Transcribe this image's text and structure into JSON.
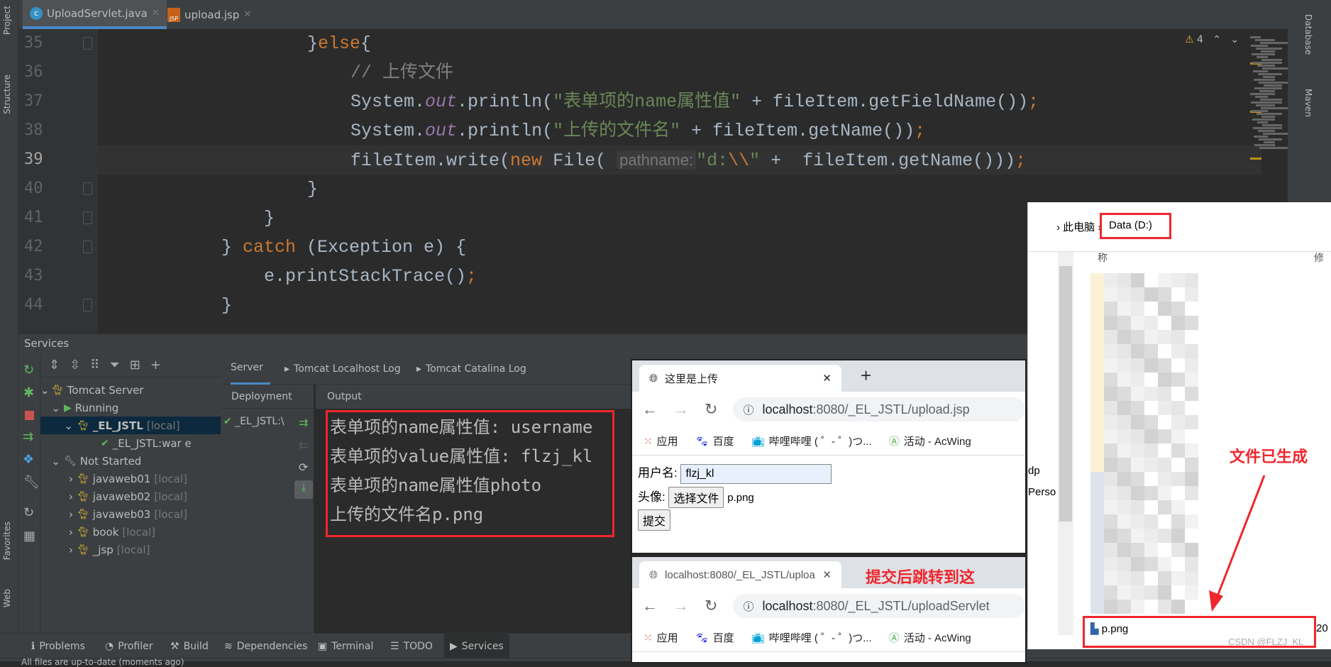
{
  "ide": {
    "left_strip": [
      "Project",
      "Structure",
      "Favorites",
      "Web"
    ],
    "right_strip": [
      "Database",
      "Maven"
    ],
    "tabs": [
      {
        "label": "UploadServlet.java",
        "active": true,
        "icon": "java-class-icon"
      },
      {
        "label": "upload.jsp",
        "active": false,
        "icon": "jsp-file-icon"
      }
    ],
    "warnings": "4",
    "line_numbers": [
      "35",
      "36",
      "37",
      "38",
      "39",
      "40",
      "41",
      "42",
      "43",
      "44"
    ],
    "current_line": "39",
    "code": {
      "l35_a": "}",
      "l35_kw": "else",
      "l35_b": "{",
      "l36": "// 上传文件",
      "l37_a": "System.",
      "l37_f": "out",
      "l37_b": ".println(",
      "l37_s": "\"表单项的name属性值\"",
      "l37_c": " + fileItem.getFieldName())",
      "l37_d": ";",
      "l38_a": "System.",
      "l38_f": "out",
      "l38_b": ".println(",
      "l38_s": "\"上传的文件名\"",
      "l38_c": " + fileItem.getName())",
      "l38_d": ";",
      "l39_a": "fileItem.write(",
      "l39_kw": "new",
      "l39_b": " File(",
      "l39_hint": "pathname:",
      "l39_s1": "\"d:",
      "l39_esc": "\\\\",
      "l39_s2": "\"",
      "l39_c": " +  fileItem.getName()))",
      "l39_d": ";",
      "l40": "}",
      "l41": "}",
      "l42_a": "} ",
      "l42_kw": "catch",
      "l42_b": " (Exception e) {",
      "l43_a": "e.printStackTrace()",
      "l43_d": ";",
      "l44": "}"
    },
    "services": {
      "title": "Services",
      "tree": [
        {
          "label": "Tomcat Server",
          "suffix": ""
        },
        {
          "label": "Running",
          "suffix": ""
        },
        {
          "label": "_EL_JSTL",
          "suffix": "[local]"
        },
        {
          "label": "_EL_JSTL:war e",
          "suffix": ""
        },
        {
          "label": "Not Started",
          "suffix": ""
        },
        {
          "label": "javaweb01",
          "suffix": "[local]"
        },
        {
          "label": "javaweb02",
          "suffix": "[local]"
        },
        {
          "label": "javaweb03",
          "suffix": "[local]"
        },
        {
          "label": "book",
          "suffix": "[local]"
        },
        {
          "label": "_jsp",
          "suffix": "[local]"
        }
      ],
      "tabs": [
        "Server",
        "Tomcat Localhost Log",
        "Tomcat Catalina Log"
      ],
      "deployment_header": "Deployment",
      "deployment_item": "_EL_JSTL:\\",
      "output_header": "Output",
      "output_lines": [
        "表单项的name属性值: username",
        "表单项的value属性值:  flzj_kl",
        "表单项的name属性值photo",
        "上传的文件名p.png"
      ]
    },
    "bottom_tabs": [
      "Problems",
      "Profiler",
      "Build",
      "Dependencies",
      "Terminal",
      "TODO",
      "Services"
    ],
    "status": "All files are up-to-date (moments ago)"
  },
  "browser1": {
    "tab_title": "这里是上传",
    "url_host": "localhost",
    "url_rest": ":8080/_EL_JSTL/upload.jsp",
    "bookmarks": [
      "应用",
      "百度",
      "哔哩哔哩 ( ゜- ゜)つ...",
      "活动 - AcWing"
    ],
    "form": {
      "username_label": "用户名:",
      "username_value": "flzj_kl",
      "avatar_label": "头像:",
      "file_button": "选择文件",
      "file_name": "p.png",
      "submit": "提交"
    }
  },
  "browser2": {
    "tab_title": "localhost:8080/_EL_JSTL/uploa",
    "url_host": "localhost",
    "url_rest": ":8080/_EL_JSTL/uploadServlet",
    "bookmarks": [
      "应用",
      "百度",
      "哔哩哔哩 ( ゜- ゜)つ...",
      "活动 - AcWing"
    ]
  },
  "explorer": {
    "breadcrumb": [
      "此电脑",
      "Data (D:)"
    ],
    "col_name": "称",
    "col_modified": "修",
    "side_labels": [
      "dp",
      "Perso"
    ],
    "file": "p.png",
    "file_date": "20"
  },
  "annotations": {
    "file_created": "文件已生成",
    "redirect": "提交后跳转到这",
    "watermark": "CSDN @FLZJ_KL",
    "color": "#f0262d"
  }
}
